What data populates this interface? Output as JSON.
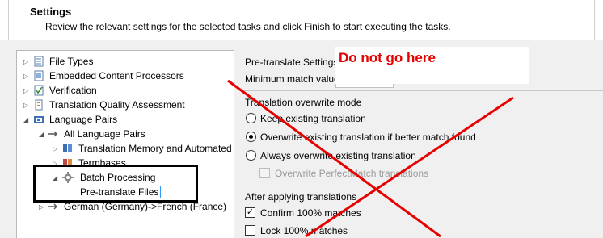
{
  "header": {
    "title": "Settings",
    "subtitle": "Review the relevant settings for the selected tasks and click Finish to start executing the tasks."
  },
  "tree": {
    "items": [
      {
        "label": "File Types",
        "icon": "file-types-icon"
      },
      {
        "label": "Embedded Content Processors",
        "icon": "embedded-content-icon"
      },
      {
        "label": "Verification",
        "icon": "verification-icon"
      },
      {
        "label": "Translation Quality Assessment",
        "icon": "tqa-icon"
      },
      {
        "label": "Language Pairs",
        "icon": "language-pairs-icon"
      },
      {
        "label": "All Language Pairs",
        "icon": "arrow-icon"
      },
      {
        "label": "Translation Memory and Automated",
        "icon": "tm-icon"
      },
      {
        "label": "Termbases",
        "icon": "termbase-icon"
      },
      {
        "label": "Batch Processing",
        "icon": "gear-icon"
      },
      {
        "label": "Pre-translate Files",
        "icon": ""
      },
      {
        "label": "German (Germany)->French (France)",
        "icon": "arrow-icon"
      }
    ]
  },
  "right": {
    "section_title": "Pre-translate Settings",
    "min_match_label": "Minimum match value:",
    "overwrite_group": "Translation overwrite mode",
    "overwrite_options": [
      {
        "label": "Keep existing translation",
        "checked": false
      },
      {
        "label": "Overwrite existing translation if better match found",
        "checked": true
      },
      {
        "label": "Always overwrite existing translation",
        "checked": false
      }
    ],
    "perfect_match_label": "Overwrite PerfectMatch translations",
    "after_group": "After applying translations",
    "after_options": [
      {
        "label": "Confirm 100% matches",
        "checked": true
      },
      {
        "label": "Lock 100% matches",
        "checked": false
      }
    ]
  },
  "annotation": {
    "warning": "Do not go here",
    "color": "#e60000"
  }
}
